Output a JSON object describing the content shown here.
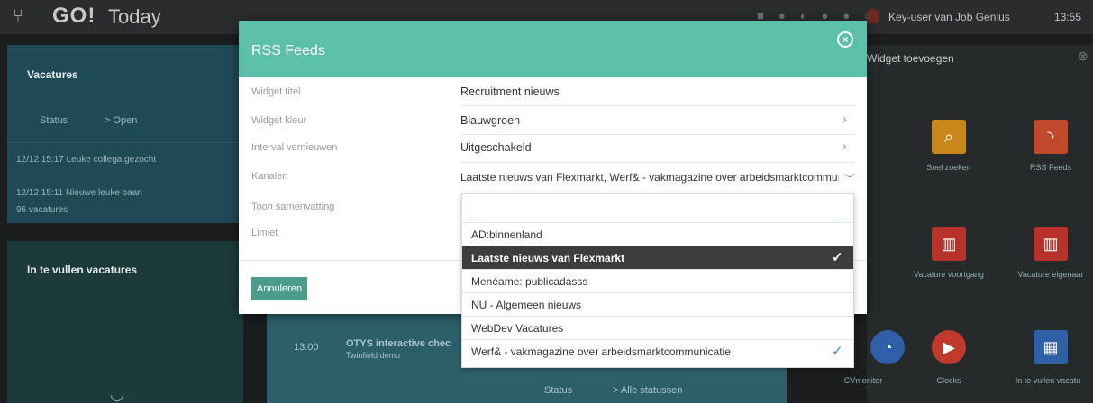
{
  "app": {
    "logo": "GO!",
    "subtitle": "Today",
    "user": "Key-user van Job Genius",
    "time": "13:55"
  },
  "background": {
    "vacatures": {
      "title": "Vacatures",
      "status_label": "Status",
      "status_value": "> Open",
      "items": [
        "12/12 15:17  Leuke collega gezocht",
        "12/12 15:11  Nieuwe leuke baan"
      ],
      "count": "96 vacatures"
    },
    "in_te_vullen": {
      "title": "In te vullen vacatures"
    },
    "mid_panel": {
      "status_label": "Status",
      "status_value": "> Alle statussen",
      "event_time": "13:00",
      "event_title": "OTYS interactive chec",
      "event_sub": "Twinfield demo"
    },
    "widgets": {
      "title": "Widget toevoegen",
      "tiles": [
        {
          "label": "Snel zoeken",
          "color": "#c9861a",
          "icon": "search-icon"
        },
        {
          "label": "RSS Feeds",
          "color": "#c0492b",
          "icon": "rss-icon"
        },
        {
          "label": "Vacature voortgang",
          "color": "#b7322b",
          "icon": "chart-icon"
        },
        {
          "label": "Vacature eigenaar",
          "color": "#b7322b",
          "icon": "chart-icon"
        },
        {
          "label": "CVmonitor",
          "color": "#2f5fa7",
          "icon": "monitor-icon"
        },
        {
          "label": "Clocks",
          "color": "#c0392b",
          "icon": "clock-icon"
        },
        {
          "label": "In te vullen vacatu",
          "color": "#2f5fa7",
          "icon": "briefcase-icon"
        }
      ]
    }
  },
  "modal": {
    "title": "RSS Feeds",
    "fields": [
      {
        "label": "Widget titel",
        "value": "Recruitment nieuws"
      },
      {
        "label": "Widget kleur",
        "value": "Blauwgroen"
      },
      {
        "label": "Interval vernieuwen",
        "value": "Uitgeschakeld"
      },
      {
        "label": "Kanalen",
        "value": "Laatste nieuws van Flexmarkt, Werf& - vakmagazine over arbeidsmarktcommuı"
      },
      {
        "label": "Toon samenvatting",
        "value": ""
      },
      {
        "label": "Limiet",
        "value": ""
      }
    ],
    "cancel_label": "Annuleren"
  },
  "dropdown": {
    "search_value": "",
    "options": [
      {
        "label": "AD:binnenland",
        "selected": false,
        "checked": false
      },
      {
        "label": "Laatste nieuws van Flexmarkt",
        "selected": true,
        "checked": true
      },
      {
        "label": "Menéame: publicadasss",
        "selected": false,
        "checked": false
      },
      {
        "label": "NU - Algemeen nieuws",
        "selected": false,
        "checked": false
      },
      {
        "label": "WebDev Vacatures",
        "selected": false,
        "checked": false
      },
      {
        "label": "Werf& - vakmagazine over arbeidsmarktcommunicatie",
        "selected": false,
        "checked": true
      }
    ],
    "check_glyph": "✓"
  }
}
